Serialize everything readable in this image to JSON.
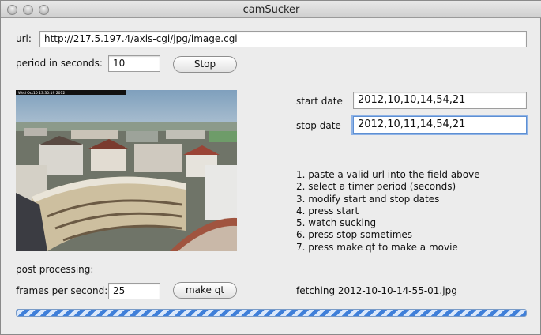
{
  "window": {
    "title": "camSucker",
    "controls": [
      "close-icon",
      "minimize-icon",
      "zoom-icon"
    ]
  },
  "url": {
    "label": "url:",
    "value": "http://217.5.197.4/axis-cgi/jpg/image.cgi"
  },
  "period": {
    "label": "period in seconds:",
    "value": "10",
    "button_label": "Stop"
  },
  "dates": {
    "start_label": "start date",
    "start_value": "2012,10,10,14,54,21",
    "stop_label": "stop date",
    "stop_value": "2012,10,11,14,54,21"
  },
  "camera": {
    "overlay_text": "Wed Oct10 13:30:19 2012"
  },
  "instructions": [
    "1. paste a valid url into the field above",
    "2. select a timer period (seconds)",
    "3. modify start and stop dates",
    "4. press start",
    "5. watch sucking",
    "6. press stop sometimes",
    "7. press make qt to make a movie"
  ],
  "post": {
    "heading": "post processing:",
    "fps_label": "frames per second:",
    "fps_value": "25",
    "button_label": "make qt",
    "status": "fetching 2012-10-10-14-55-01.jpg"
  },
  "progress": {
    "state": "indeterminate"
  }
}
